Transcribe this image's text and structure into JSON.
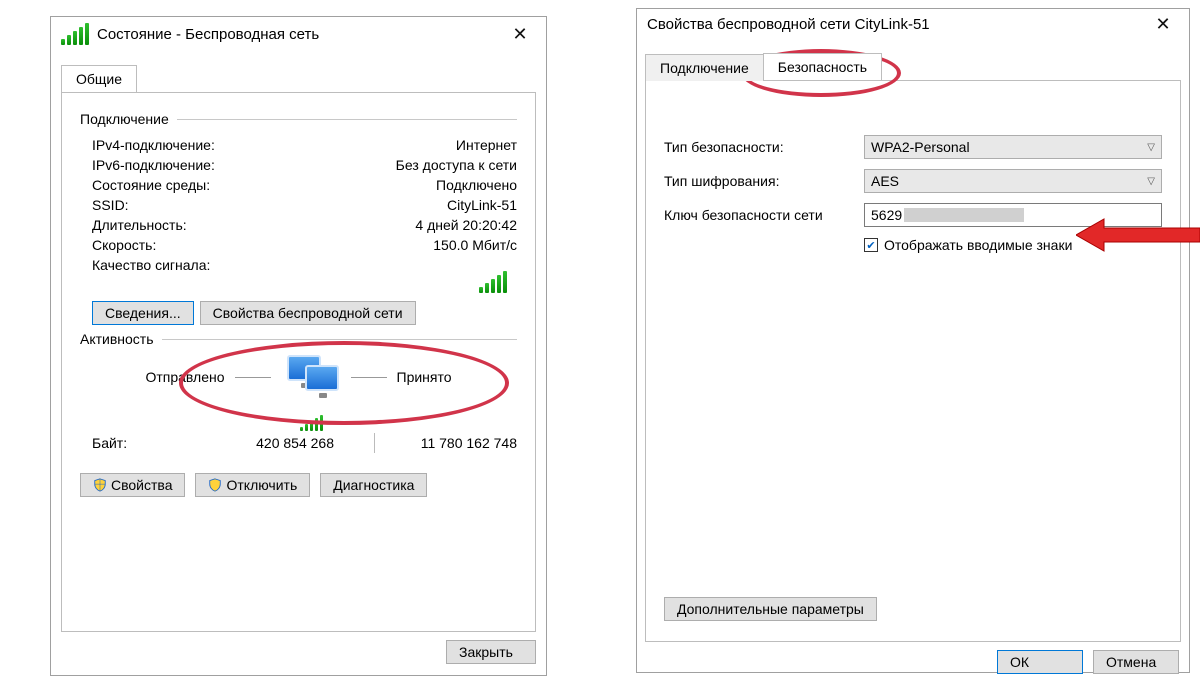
{
  "status": {
    "title": "Состояние - Беспроводная сеть",
    "tab_general": "Общие",
    "group_connection": "Подключение",
    "rows": {
      "ipv4_label": "IPv4-подключение:",
      "ipv4_value": "Интернет",
      "ipv6_label": "IPv6-подключение:",
      "ipv6_value": "Без доступа к сети",
      "media_label": "Состояние среды:",
      "media_value": "Подключено",
      "ssid_label": "SSID:",
      "ssid_value": "CityLink-51",
      "duration_label": "Длительность:",
      "duration_value": "4 дней 20:20:42",
      "speed_label": "Скорость:",
      "speed_value": "150.0 Мбит/с",
      "signal_label": "Качество сигнала:"
    },
    "details_btn": "Сведения...",
    "wprops_btn": "Свойства беспроводной сети",
    "group_activity": "Активность",
    "sent_label": "Отправлено",
    "recv_label": "Принято",
    "bytes_label": "Байт:",
    "bytes_sent": "420 854 268",
    "bytes_recv": "11 780 162 748",
    "props_btn": "Свойства",
    "disable_btn": "Отключить",
    "diag_btn": "Диагностика",
    "close_btn": "Закрыть"
  },
  "props": {
    "title": "Свойства беспроводной сети CityLink-51",
    "tab_connection": "Подключение",
    "tab_security": "Безопасность",
    "sec_type_label": "Тип безопасности:",
    "sec_type_value": "WPA2-Personal",
    "enc_type_label": "Тип шифрования:",
    "enc_type_value": "AES",
    "key_label": "Ключ безопасности сети",
    "key_value_visible": "5629",
    "show_chars": "Отображать вводимые знаки",
    "adv_btn": "Дополнительные параметры",
    "ok_btn": "ОК",
    "cancel_btn": "Отмена"
  }
}
